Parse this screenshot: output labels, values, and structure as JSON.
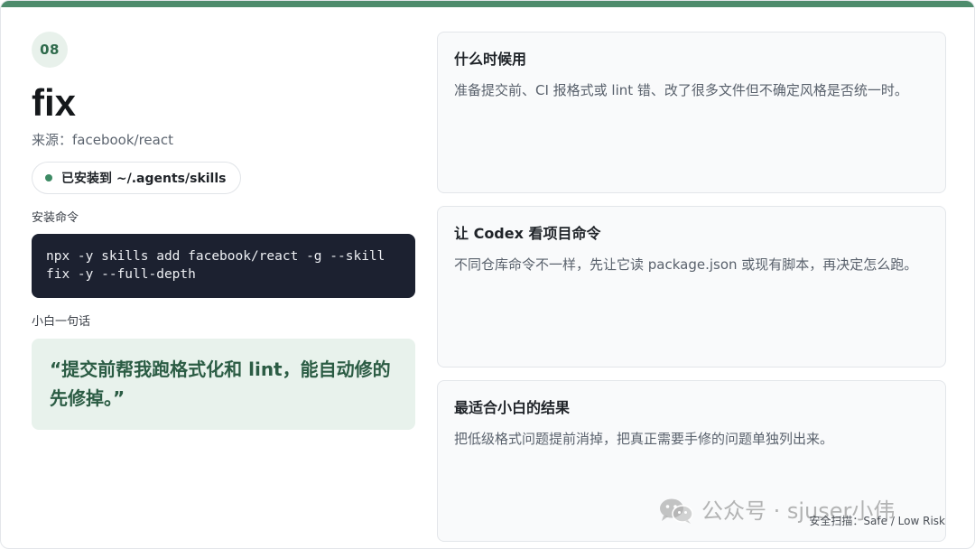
{
  "slide": {
    "number": "08",
    "title": "fix",
    "source": "来源：facebook/react",
    "installed": "已安装到 ~/.agents/skills",
    "install_label": "安装命令",
    "install_command": "npx -y skills add facebook/react -g --skill\nfix -y --full-depth",
    "quote_label": "小白一句话",
    "quote": "“提交前帮我跑格式化和 lint，能自动修的先修掉。”"
  },
  "cards": [
    {
      "title": "什么时候用",
      "body": "准备提交前、CI 报格式或 lint 错、改了很多文件但不确定风格是否统一时。"
    },
    {
      "title": "让 Codex 看项目命令",
      "body": "不同仓库命令不一样，先让它读 package.json 或现有脚本，再决定怎么跑。"
    },
    {
      "title": "最适合小白的结果",
      "body": "把低级格式问题提前消掉，把真正需要手修的问题单独列出来。"
    }
  ],
  "watermark": {
    "icon": "wechat-icon",
    "text": "公众号 · sjuser小伟"
  },
  "safety_scan": "安全扫描：Safe / Low Risk",
  "colors": {
    "accent": "#4e8c6c",
    "code_bg": "#1c2130",
    "quote_bg": "#e8f2ec",
    "quote_text": "#2b5c44"
  }
}
